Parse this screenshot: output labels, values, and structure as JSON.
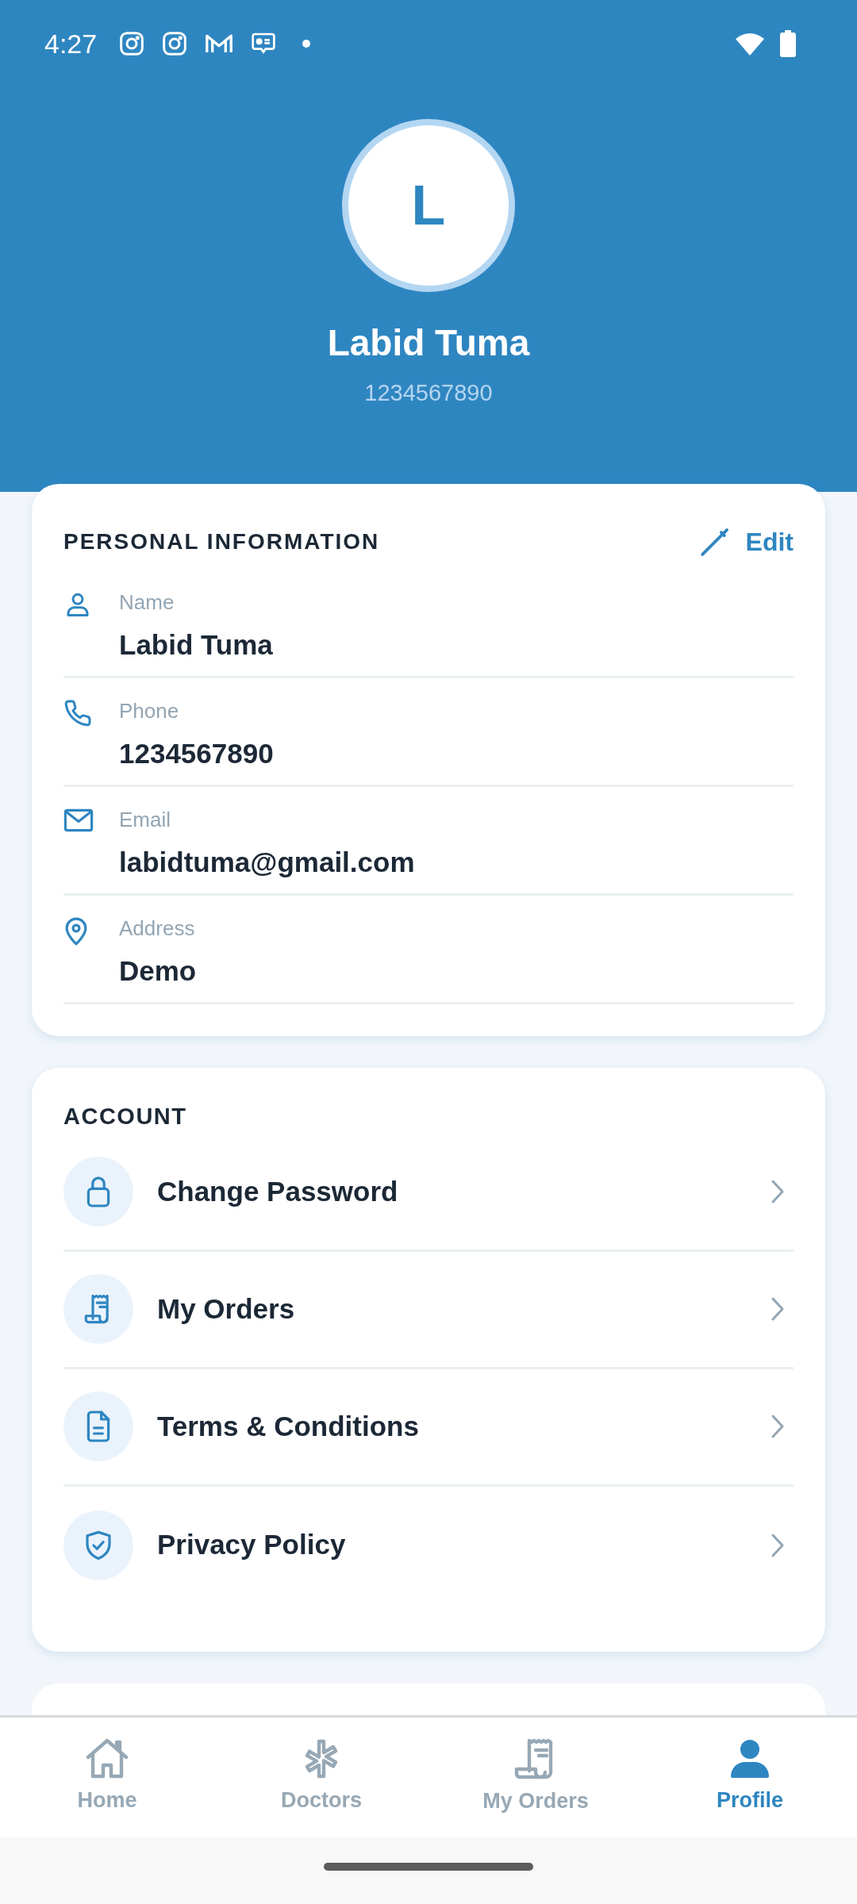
{
  "status_bar": {
    "time": "4:27"
  },
  "profile": {
    "initial": "L",
    "name": "Labid Tuma",
    "phone": "1234567890"
  },
  "personal_information": {
    "title": "PERSONAL INFORMATION",
    "edit": "Edit",
    "fields": [
      {
        "kind": "name",
        "label": "Name",
        "value": "Labid Tuma"
      },
      {
        "kind": "phone",
        "label": "Phone",
        "value": "1234567890"
      },
      {
        "kind": "email",
        "label": "Email",
        "value": "labidtuma@gmail.com"
      },
      {
        "kind": "address",
        "label": "Address",
        "value": "Demo"
      }
    ]
  },
  "account": {
    "title": "ACCOUNT",
    "items": [
      {
        "kind": "password",
        "label": "Change Password"
      },
      {
        "kind": "orders",
        "label": "My Orders"
      },
      {
        "kind": "terms",
        "label": "Terms & Conditions"
      },
      {
        "kind": "privacy",
        "label": "Privacy Policy"
      }
    ]
  },
  "bottom_nav": [
    {
      "kind": "home",
      "label": "Home",
      "selected": false
    },
    {
      "kind": "doctors",
      "label": "Doctors",
      "selected": false
    },
    {
      "kind": "orders",
      "label": "My Orders",
      "selected": false
    },
    {
      "kind": "profile",
      "label": "Profile",
      "selected": true
    }
  ]
}
